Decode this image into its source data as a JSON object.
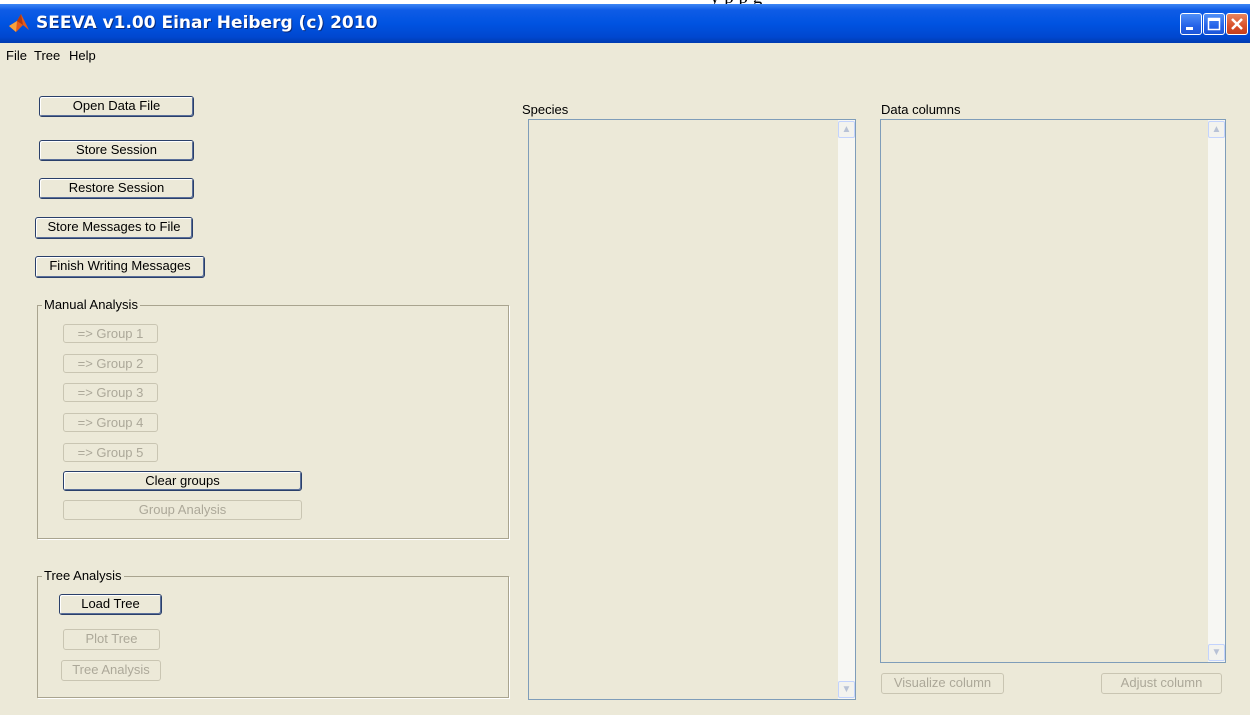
{
  "document": {
    "partial_text": "y        p        p   g"
  },
  "window": {
    "title": "SEEVA v1.00 Einar Heiberg (c) 2010",
    "controls": {
      "minimize": "minimize-icon",
      "maximize": "maximize-icon",
      "close": "close-icon"
    }
  },
  "menu": {
    "items": [
      "File",
      "Tree",
      "Help"
    ]
  },
  "left": {
    "open_data_file": "Open Data File",
    "store_session": "Store Session",
    "restore_session": "Restore Session",
    "store_messages": "Store Messages to File",
    "finish_messages": "Finish Writing Messages"
  },
  "manual_analysis": {
    "label": "Manual Analysis",
    "group_buttons": [
      "=> Group 1",
      "=> Group 2",
      "=> Group 3",
      "=> Group 4",
      "=> Group 5"
    ],
    "clear_groups": "Clear groups",
    "group_analysis": "Group Analysis"
  },
  "tree_analysis": {
    "label": "Tree Analysis",
    "load_tree": "Load Tree",
    "plot_tree": "Plot Tree",
    "tree_analysis": "Tree Analysis"
  },
  "species": {
    "label": "Species"
  },
  "data_columns": {
    "label": "Data columns",
    "visualize_column": "Visualize column",
    "adjust_column": "Adjust column"
  },
  "colors": {
    "title_bar": "#0053e1",
    "window_bg": "#ece9d8",
    "disabled_text": "#aca899"
  }
}
